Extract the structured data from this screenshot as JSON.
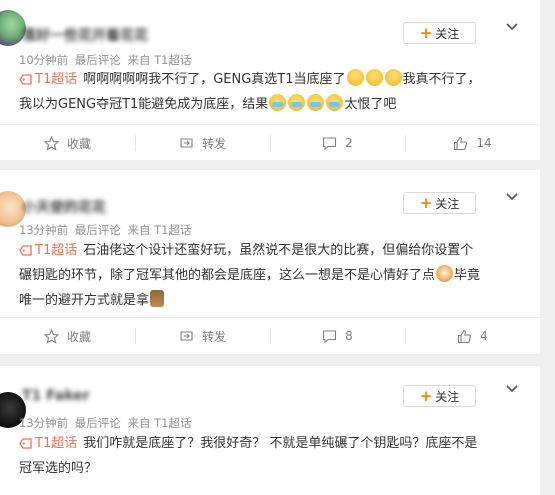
{
  "follow_label": "关注",
  "posts": [
    {
      "username": "落好一些花开着花花",
      "time": "10分钟前",
      "meta": "最后评论",
      "source": "来自 T1超话",
      "topic": "T1超话",
      "text1": "啊啊啊啊啊我不行了，GENG真选T1当底座了",
      "text2": "我真不行了，",
      "text3": "我以为GENG夺冠T1能避免成为底座，结果",
      "text4": "太恨了吧",
      "actions": {
        "collect": "收藏",
        "repost": "转发",
        "comments": "2",
        "likes": "14"
      }
    },
    {
      "username": "小天使的花花",
      "time": "13分钟前",
      "meta": "最后评论",
      "source": "来自 T1超话",
      "topic": "T1超话",
      "text1": "石油佬这个设计还蛮好玩，虽然说不是很大的比赛，但偏给你设置个",
      "text2": "碾钥匙的环节，除了冠军其他的都会是底座，这么一想是不是心情好了点",
      "text3": "毕竟",
      "text4": "唯一的避开方式就是拿",
      "actions": {
        "collect": "收藏",
        "repost": "转发",
        "comments": "8",
        "likes": "4"
      }
    },
    {
      "username": "T1 Faker",
      "time": "13分钟前",
      "meta": "最后评论",
      "source": "来自 T1超话",
      "topic": "T1超话",
      "text1": "我们咋就是底座了？我很好奇？ 不就是单纯碾了个钥匙吗？底座不是",
      "text2": "冠军选的吗？"
    }
  ],
  "icons": {
    "follow": "plus-icon",
    "menu": "chevron-down-icon",
    "topic": "super-topic-tag-icon",
    "collect": "star-icon",
    "repost": "repost-icon",
    "comment": "comment-bubble-icon",
    "like": "thumbs-up-icon"
  },
  "colors": {
    "topic": "#eb7350",
    "accent": "#ff8200",
    "meta": "#939393",
    "bg": "#efefef"
  }
}
